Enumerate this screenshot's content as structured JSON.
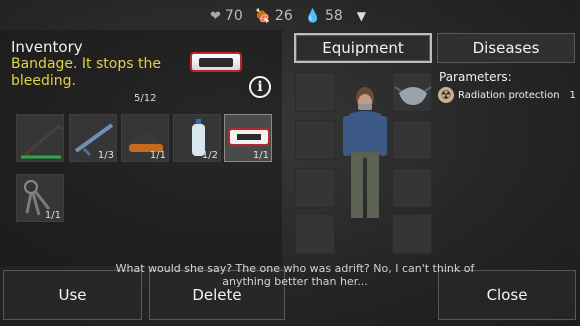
{
  "status": {
    "health": "70",
    "food": "26",
    "water": "58",
    "health_icon": "heart-icon",
    "food_icon": "meat-icon",
    "water_icon": "water-drop-icon"
  },
  "inventory": {
    "title": "Inventory",
    "description": "Bandage. It stops the bleeding.",
    "capacity": "5/12",
    "items": [
      {
        "name": "crowbar",
        "qty": ""
      },
      {
        "name": "rifle",
        "qty": "1/3"
      },
      {
        "name": "beanie-hat",
        "qty": "1/1"
      },
      {
        "name": "water-bottle",
        "qty": "1/2"
      },
      {
        "name": "bandage",
        "qty": "1/1"
      },
      {
        "name": "keys",
        "qty": "1/1"
      }
    ]
  },
  "tabs": {
    "equipment": "Equipment",
    "diseases": "Diseases"
  },
  "parameters": {
    "title": "Parameters:",
    "items": [
      {
        "label": "Radiation protection",
        "value": "1",
        "icon": "radiation-icon"
      }
    ]
  },
  "subtitle": "What would she say? The one who was adrift? No, I can't think of anything better than her...",
  "buttons": {
    "use": "Use",
    "delete": "Delete",
    "close": "Close"
  },
  "colors": {
    "description": "#e0d24a",
    "bandage_border": "#b5282d"
  }
}
